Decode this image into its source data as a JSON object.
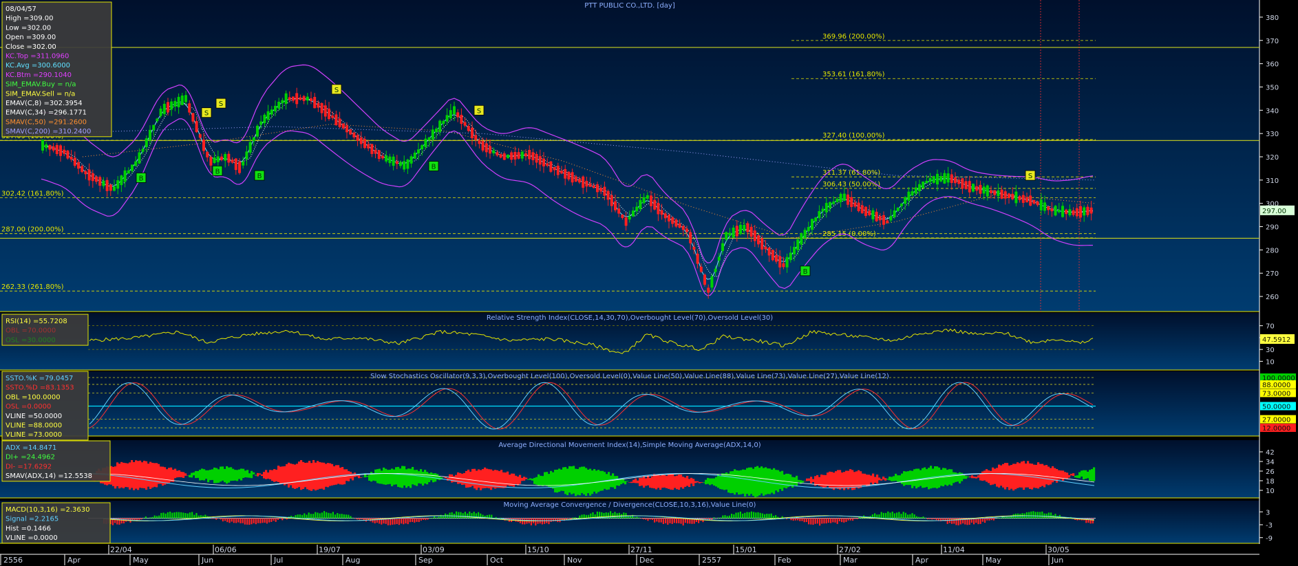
{
  "title": "PTT PUBLIC CO.,LTD. [day]",
  "last_price_label": "297.00",
  "colors": {
    "background_top": "#001536",
    "background_bottom": "#003a6a",
    "panel_border": "#e6e600",
    "axis_text": "#cfd6e6",
    "up_candle": "#00d000",
    "down_candle": "#ff2020",
    "kc_band": "#d040ff",
    "kc_avg": "#80e0ff",
    "fib_line": "#e6e600",
    "rsi_line": "#e6e600",
    "k_line": "#60d0ff",
    "d_line": "#ff3030",
    "adx_plus": "#00d000",
    "adx_minus": "#ff2020"
  },
  "info_box": {
    "lines": [
      {
        "text": "08/04/57",
        "color": "#ffffff"
      },
      {
        "text": "High  =309.00",
        "color": "#ffffff"
      },
      {
        "text": "Low   =302.00",
        "color": "#ffffff"
      },
      {
        "text": "Open  =309.00",
        "color": "#ffffff"
      },
      {
        "text": "Close  =302.00",
        "color": "#ffffff"
      },
      {
        "text": "KC.Top   =311.0960",
        "color": "#e040ff"
      },
      {
        "text": "KC.Avg   =300.6000",
        "color": "#60e0ff"
      },
      {
        "text": "KC.Btm   =290.1040",
        "color": "#e040ff"
      },
      {
        "text": "SIM_EMAV.Buy    = n/a",
        "color": "#40ff40"
      },
      {
        "text": "SIM_EMAV.Sell    = n/a",
        "color": "#ffff40"
      },
      {
        "text": "EMAV(C,8)   =302.3954",
        "color": "#ffffff"
      },
      {
        "text": "EMAV(C,34)   =296.1771",
        "color": "#ffffff"
      },
      {
        "text": "SMAV(C,50)   =291.2600",
        "color": "#ff9030"
      },
      {
        "text": "SMAV(C,200)  =310.2400",
        "color": "#a0a0ff"
      }
    ]
  },
  "price_panel": {
    "ymin": 255,
    "ymax": 385,
    "ticks": [
      260,
      270,
      280,
      290,
      300,
      310,
      320,
      330,
      340,
      350,
      360,
      370,
      380
    ],
    "fib_left": [
      {
        "label": "327.09 (100.00%)",
        "value": 327.09
      },
      {
        "label": "302.42 (161.80%)",
        "value": 302.42
      },
      {
        "label": "287.00 (200.00%)",
        "value": 287.0
      },
      {
        "label": "262.33 (261.80%)",
        "value": 262.33
      }
    ],
    "fib_right": [
      {
        "label": "369.96 (200.00%)",
        "value": 369.96
      },
      {
        "label": "353.61 (161.80%)",
        "value": 353.61
      },
      {
        "label": "327.40 (100.00%)",
        "value": 327.4
      },
      {
        "label": "311.37 (61.80%)",
        "value": 311.37
      },
      {
        "label": "306.43 (50.00%)",
        "value": 306.43
      },
      {
        "label": "285.15 (0.00%)",
        "value": 285.15
      }
    ],
    "solid_levels": [
      367,
      327,
      285
    ],
    "signals": [
      {
        "label": "B",
        "x": 205,
        "price": 311,
        "type": "buy"
      },
      {
        "label": "S",
        "x": 300,
        "price": 339,
        "type": "sell"
      },
      {
        "label": "S",
        "x": 321,
        "price": 343,
        "type": "sell"
      },
      {
        "label": "B",
        "x": 316,
        "price": 314,
        "type": "buy"
      },
      {
        "label": "B",
        "x": 377,
        "price": 312,
        "type": "buy"
      },
      {
        "label": "S",
        "x": 489,
        "price": 349,
        "type": "sell"
      },
      {
        "label": "B",
        "x": 630,
        "price": 316,
        "type": "buy"
      },
      {
        "label": "S",
        "x": 696,
        "price": 340,
        "type": "sell"
      },
      {
        "label": "B",
        "x": 1170,
        "price": 271,
        "type": "buy"
      },
      {
        "label": "S",
        "x": 1497,
        "price": 312,
        "type": "sell"
      }
    ],
    "anchors": [
      {
        "x": 62,
        "p": 325
      },
      {
        "x": 95,
        "p": 322
      },
      {
        "x": 125,
        "p": 313
      },
      {
        "x": 165,
        "p": 306
      },
      {
        "x": 200,
        "p": 318
      },
      {
        "x": 235,
        "p": 340
      },
      {
        "x": 270,
        "p": 345
      },
      {
        "x": 305,
        "p": 318
      },
      {
        "x": 330,
        "p": 320
      },
      {
        "x": 350,
        "p": 315
      },
      {
        "x": 380,
        "p": 335
      },
      {
        "x": 415,
        "p": 345
      },
      {
        "x": 450,
        "p": 345
      },
      {
        "x": 480,
        "p": 338
      },
      {
        "x": 520,
        "p": 328
      },
      {
        "x": 555,
        "p": 320
      },
      {
        "x": 590,
        "p": 316
      },
      {
        "x": 630,
        "p": 330
      },
      {
        "x": 660,
        "p": 340
      },
      {
        "x": 700,
        "p": 325
      },
      {
        "x": 730,
        "p": 320
      },
      {
        "x": 770,
        "p": 321
      },
      {
        "x": 805,
        "p": 315
      },
      {
        "x": 840,
        "p": 310
      },
      {
        "x": 880,
        "p": 305
      },
      {
        "x": 910,
        "p": 292
      },
      {
        "x": 940,
        "p": 303
      },
      {
        "x": 965,
        "p": 295
      },
      {
        "x": 1000,
        "p": 288
      },
      {
        "x": 1030,
        "p": 262
      },
      {
        "x": 1055,
        "p": 286
      },
      {
        "x": 1085,
        "p": 290
      },
      {
        "x": 1115,
        "p": 280
      },
      {
        "x": 1140,
        "p": 273
      },
      {
        "x": 1165,
        "p": 285
      },
      {
        "x": 1195,
        "p": 297
      },
      {
        "x": 1225,
        "p": 303
      },
      {
        "x": 1255,
        "p": 297
      },
      {
        "x": 1290,
        "p": 292
      },
      {
        "x": 1320,
        "p": 303
      },
      {
        "x": 1350,
        "p": 310
      },
      {
        "x": 1380,
        "p": 311
      },
      {
        "x": 1410,
        "p": 307
      },
      {
        "x": 1440,
        "p": 305
      },
      {
        "x": 1470,
        "p": 303
      },
      {
        "x": 1500,
        "p": 301
      },
      {
        "x": 1530,
        "p": 297
      },
      {
        "x": 1560,
        "p": 296
      },
      {
        "x": 1588,
        "p": 297
      }
    ],
    "sma200": [
      {
        "x": 60,
        "p": 330
      },
      {
        "x": 400,
        "p": 333
      },
      {
        "x": 700,
        "p": 330
      },
      {
        "x": 1000,
        "p": 322
      },
      {
        "x": 1300,
        "p": 312
      },
      {
        "x": 1590,
        "p": 310
      }
    ],
    "sma50": [
      {
        "x": 120,
        "p": 320
      },
      {
        "x": 300,
        "p": 326
      },
      {
        "x": 480,
        "p": 334
      },
      {
        "x": 650,
        "p": 331
      },
      {
        "x": 820,
        "p": 318
      },
      {
        "x": 1000,
        "p": 299
      },
      {
        "x": 1150,
        "p": 285
      },
      {
        "x": 1300,
        "p": 292
      },
      {
        "x": 1450,
        "p": 304
      },
      {
        "x": 1590,
        "p": 300
      }
    ]
  },
  "rsi_panel": {
    "title": "Relative Strength Index(CLOSE,14,30,70),Overbought Level(70),Oversold Level(30)",
    "legend": [
      {
        "text": "RSI(14)    =55.7208",
        "color": "#ffff40"
      },
      {
        "text": "OBL   =70.0000",
        "color": "#a03030"
      },
      {
        "text": "OSL   =30.0000",
        "color": "#208020"
      }
    ],
    "ymin": 0,
    "ymax": 80,
    "ticks": [
      10,
      30,
      50,
      70
    ],
    "value_label": "47.5912",
    "anchors": [
      {
        "x": 130,
        "v": 45
      },
      {
        "x": 200,
        "v": 50
      },
      {
        "x": 260,
        "v": 60
      },
      {
        "x": 300,
        "v": 42
      },
      {
        "x": 360,
        "v": 55
      },
      {
        "x": 420,
        "v": 62
      },
      {
        "x": 470,
        "v": 47
      },
      {
        "x": 520,
        "v": 50
      },
      {
        "x": 580,
        "v": 40
      },
      {
        "x": 640,
        "v": 60
      },
      {
        "x": 690,
        "v": 55
      },
      {
        "x": 740,
        "v": 45
      },
      {
        "x": 800,
        "v": 48
      },
      {
        "x": 860,
        "v": 38
      },
      {
        "x": 905,
        "v": 22
      },
      {
        "x": 940,
        "v": 55
      },
      {
        "x": 980,
        "v": 40
      },
      {
        "x": 1020,
        "v": 30
      },
      {
        "x": 1050,
        "v": 52
      },
      {
        "x": 1100,
        "v": 45
      },
      {
        "x": 1140,
        "v": 36
      },
      {
        "x": 1180,
        "v": 60
      },
      {
        "x": 1220,
        "v": 55
      },
      {
        "x": 1260,
        "v": 50
      },
      {
        "x": 1300,
        "v": 45
      },
      {
        "x": 1340,
        "v": 58
      },
      {
        "x": 1380,
        "v": 63
      },
      {
        "x": 1420,
        "v": 55
      },
      {
        "x": 1460,
        "v": 58
      },
      {
        "x": 1500,
        "v": 42
      },
      {
        "x": 1540,
        "v": 48
      },
      {
        "x": 1570,
        "v": 40
      },
      {
        "x": 1590,
        "v": 48
      }
    ]
  },
  "stoch_panel": {
    "title": "Slow Stochastics Oscillator(9,3,3),Overbought Level(100),Oversold Level(0),Value Line(50),Value Line(88),Value Line(73),Value Line(27),Value Line(12)",
    "legend": [
      {
        "text": "SSTO.%K   =79.0457",
        "color": "#60d0ff"
      },
      {
        "text": "SSTO.%D   =83.1353",
        "color": "#ff3030"
      },
      {
        "text": "OBL   =100.0000",
        "color": "#ffff40"
      },
      {
        "text": "OSL   =0.0000",
        "color": "#ff3030"
      },
      {
        "text": "VLINE   =50.0000",
        "color": "#ffffff"
      },
      {
        "text": "VLINE   =88.0000",
        "color": "#ffff40"
      },
      {
        "text": "VLINE   =73.0000",
        "color": "#ffff40"
      }
    ],
    "ymin": 0,
    "ymax": 100,
    "levels": [
      {
        "value": 100,
        "label": "100.0000",
        "color": "#00d000"
      },
      {
        "value": 88,
        "label": "88.0000",
        "color": "#ffff00"
      },
      {
        "value": 73,
        "label": "73.0000",
        "color": "#ffff00"
      },
      {
        "value": 50,
        "label": "50.0000",
        "color": "#00ffff"
      },
      {
        "value": 27,
        "label": "27.0000",
        "color": "#ffff00"
      },
      {
        "value": 12,
        "label": "12.0000",
        "color": "#ff2020"
      }
    ]
  },
  "adx_panel": {
    "title": "Average Directional Movement Index(14),Simple Moving Average(ADX,14,0)",
    "legend": [
      {
        "text": "ADX   =14.8471",
        "color": "#60d0ff"
      },
      {
        "text": "DI+   =24.4962",
        "color": "#40ff40"
      },
      {
        "text": "DI-   =17.6292",
        "color": "#ff3030"
      },
      {
        "text": "SMAV(ADX,14)   =12.5538",
        "color": "#ffffff"
      }
    ],
    "ymin": 6,
    "ymax": 46,
    "ticks": [
      10,
      18,
      26,
      34,
      42
    ]
  },
  "macd_panel": {
    "title": "Moving Average Convergence / Divergence(CLOSE,10,3,16),Value Line(0)",
    "legend": [
      {
        "text": "MACD(10,3,16)   =2.3630",
        "color": "#ffff40"
      },
      {
        "text": "Signal   =2.2165",
        "color": "#60d0ff"
      },
      {
        "text": "Hist   =0.1466",
        "color": "#ffffff"
      },
      {
        "text": "VLINE   =0.0000",
        "color": "#ffffff"
      }
    ],
    "ymin": -11,
    "ymax": 5,
    "ticks": [
      3,
      -3,
      -9
    ]
  },
  "x_axis": {
    "date_labels": [
      {
        "x": 158,
        "label": "22/04"
      },
      {
        "x": 310,
        "label": "06/06"
      },
      {
        "x": 461,
        "label": "19/07"
      },
      {
        "x": 612,
        "label": "03/09"
      },
      {
        "x": 764,
        "label": "15/10"
      },
      {
        "x": 914,
        "label": "27/11"
      },
      {
        "x": 1066,
        "label": "15/01"
      },
      {
        "x": 1217,
        "label": "27/02"
      },
      {
        "x": 1368,
        "label": "11/04"
      },
      {
        "x": 1520,
        "label": "30/05"
      }
    ],
    "month_labels": [
      {
        "x": 5,
        "label": "2556"
      },
      {
        "x": 98,
        "label": "Apr"
      },
      {
        "x": 193,
        "label": "May"
      },
      {
        "x": 293,
        "label": "Jun"
      },
      {
        "x": 398,
        "label": "Jul"
      },
      {
        "x": 502,
        "label": "Aug"
      },
      {
        "x": 608,
        "label": "Sep"
      },
      {
        "x": 712,
        "label": "Oct"
      },
      {
        "x": 824,
        "label": "Nov"
      },
      {
        "x": 929,
        "label": "Dec"
      },
      {
        "x": 1020,
        "label": "2557"
      },
      {
        "x": 1130,
        "label": "Feb"
      },
      {
        "x": 1225,
        "label": "Mar"
      },
      {
        "x": 1330,
        "label": "Apr"
      },
      {
        "x": 1432,
        "label": "May"
      },
      {
        "x": 1528,
        "label": "Jun"
      }
    ]
  },
  "chart_data": {
    "type": "candlestick",
    "title": "PTT PUBLIC CO.,LTD. [day]",
    "ylim": [
      255,
      385
    ],
    "last_close": 297.0,
    "selected_bar": {
      "date": "08/04/57",
      "high": 309.0,
      "low": 302.0,
      "open": 309.0,
      "close": 302.0
    },
    "keltner_channel": {
      "top": 311.096,
      "avg": 300.6,
      "bottom": 290.104
    },
    "moving_averages": {
      "EMAV(C,8)": 302.3954,
      "EMAV(C,34)": 296.1771,
      "SMAV(C,50)": 291.26,
      "SMAV(C,200)": 310.24
    },
    "fibonacci_levels_left": [
      327.09,
      302.42,
      287.0,
      262.33
    ],
    "fibonacci_levels_right": [
      369.96,
      353.61,
      327.4,
      311.37,
      306.43,
      285.15
    ],
    "indicators": {
      "RSI(14)": 55.7208,
      "SSTO.%K": 79.0457,
      "SSTO.%D": 83.1353,
      "ADX": 14.8471,
      "DI+": 24.4962,
      "DI-": 17.6292,
      "SMAV(ADX,14)": 12.5538,
      "MACD(10,3,16)": 2.363,
      "Signal": 2.2165,
      "Hist": 0.1466
    }
  }
}
